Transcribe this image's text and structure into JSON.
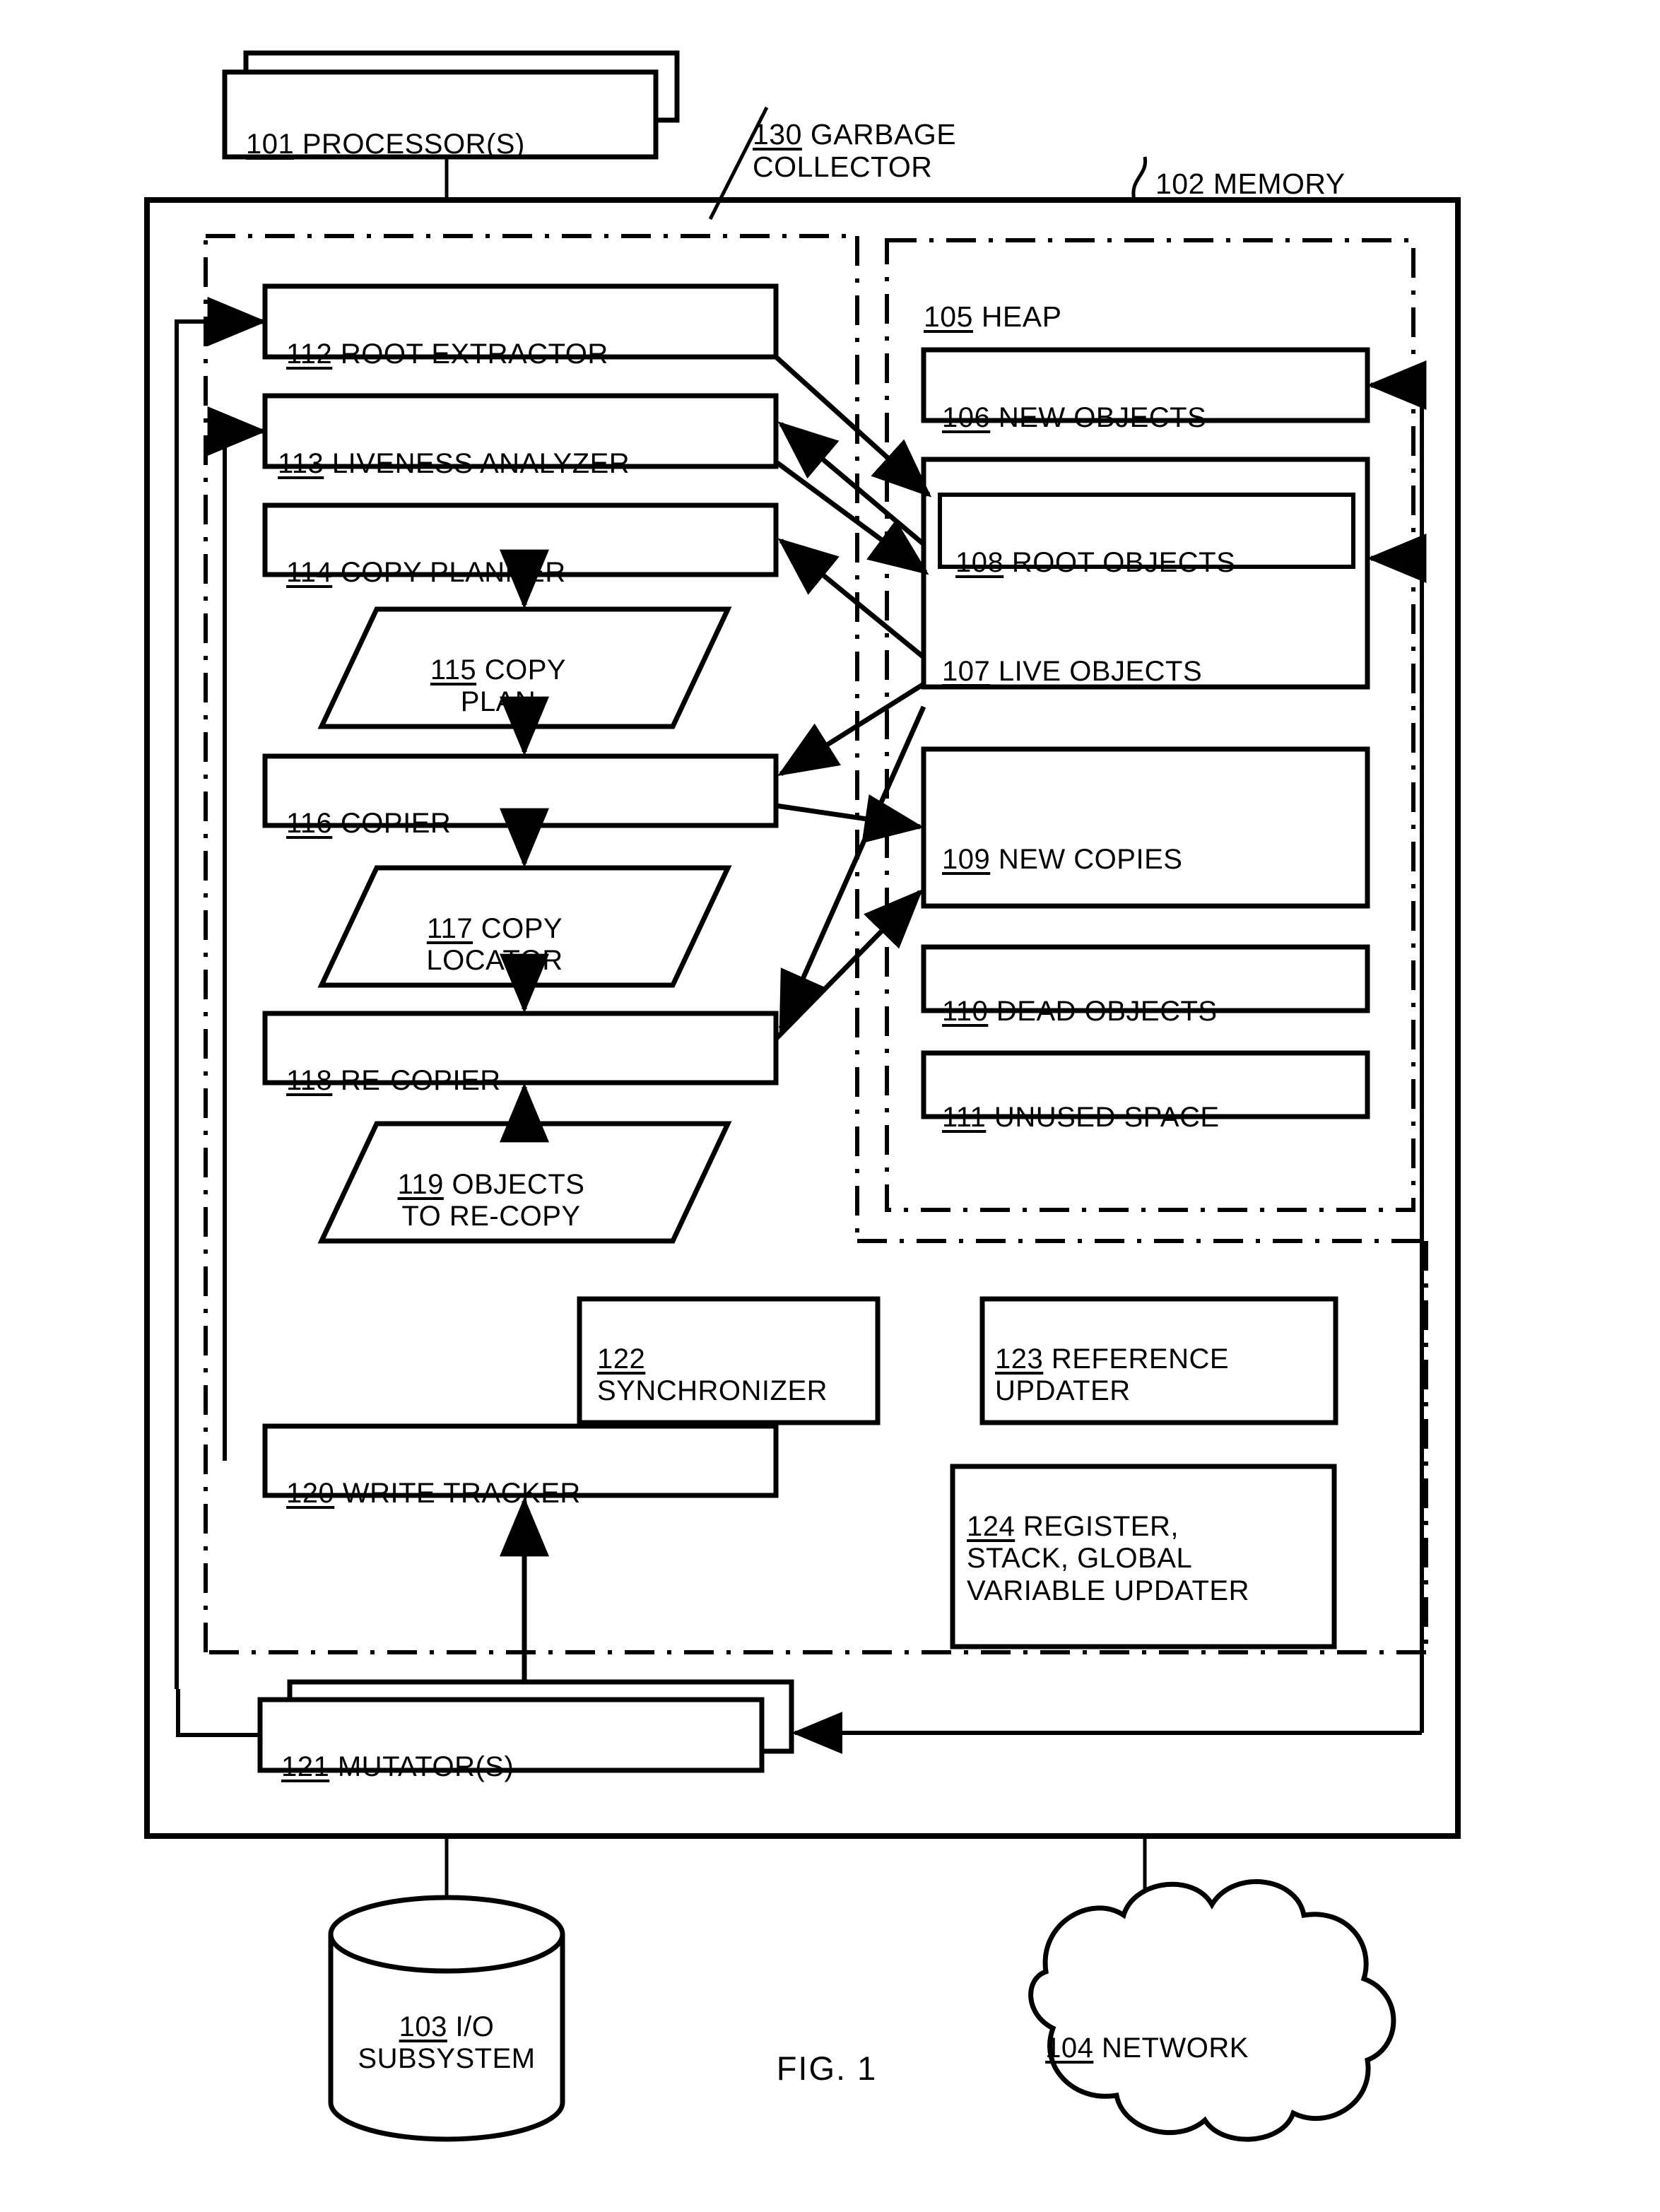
{
  "figure": {
    "caption": "FIG. 1",
    "title_blocks": {
      "garbage_collector": {
        "ref": "130",
        "text": " GARBAGE\nCOLLECTOR"
      },
      "memory": {
        "ref": "102",
        "text": " MEMORY"
      },
      "heap": {
        "ref": "105",
        "text": " HEAP"
      }
    }
  },
  "processor": {
    "ref": "101",
    "text": " PROCESSOR(S)",
    "shape": "double-box"
  },
  "gc_pipeline": [
    {
      "ref": "112",
      "text": " ROOT EXTRACTOR",
      "shape": "rect"
    },
    {
      "ref": "113",
      "text": " LIVENESS ANALYZER",
      "shape": "rect"
    },
    {
      "ref": "114",
      "text": " COPY PLANNER",
      "shape": "rect"
    },
    {
      "ref": "115",
      "text": " COPY\nPLAN",
      "shape": "parallelogram"
    },
    {
      "ref": "116",
      "text": " COPIER",
      "shape": "rect"
    },
    {
      "ref": "117",
      "text": " COPY\nLOCATOR",
      "shape": "parallelogram"
    },
    {
      "ref": "118",
      "text": " RE-COPIER",
      "shape": "rect"
    },
    {
      "ref": "119",
      "text": " OBJECTS\nTO RE-COPY",
      "shape": "parallelogram"
    },
    {
      "ref": "120",
      "text": " WRITE TRACKER",
      "shape": "rect"
    }
  ],
  "heap_regions": [
    {
      "ref": "106",
      "text": " NEW OBJECTS",
      "shape": "rect"
    },
    {
      "ref": "107",
      "text": " LIVE OBJECTS",
      "shape": "rect"
    },
    {
      "ref": "108",
      "text": " ROOT OBJECTS",
      "shape": "rect-nested"
    },
    {
      "ref": "109",
      "text": " NEW COPIES",
      "shape": "rect"
    },
    {
      "ref": "110",
      "text": " DEAD OBJECTS",
      "shape": "rect"
    },
    {
      "ref": "111",
      "text": " UNUSED SPACE",
      "shape": "rect"
    }
  ],
  "support_modules": [
    {
      "ref": "122",
      "text": "\nSYNCHRONIZER",
      "shape": "rect"
    },
    {
      "ref": "123",
      "text": " REFERENCE\nUPDATER",
      "shape": "rect"
    },
    {
      "ref": "124",
      "text": " REGISTER,\nSTACK, GLOBAL\nVARIABLE UPDATER",
      "shape": "rect"
    }
  ],
  "mutators": {
    "ref": "121",
    "text": " MUTATOR(S)",
    "shape": "double-box"
  },
  "peripherals": [
    {
      "ref": "103",
      "text": " I/O\nSUBSYSTEM",
      "shape": "cylinder"
    },
    {
      "ref": "104",
      "text": " NETWORK",
      "shape": "cloud"
    }
  ],
  "colors": {
    "stroke": "#000000",
    "fill": "#ffffff"
  }
}
